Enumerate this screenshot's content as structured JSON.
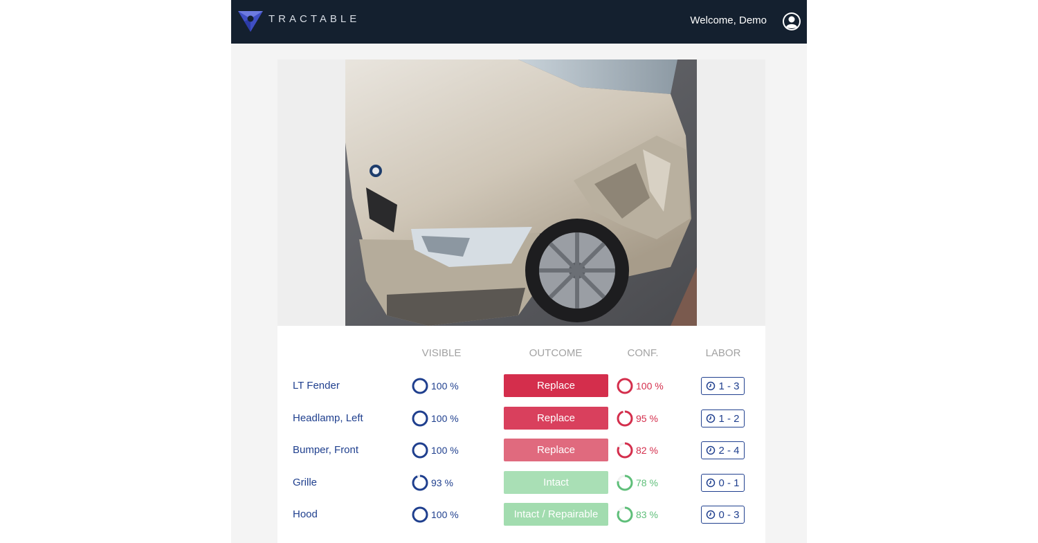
{
  "header": {
    "brand": "TRACTABLE",
    "welcome": "Welcome, Demo"
  },
  "columns": {
    "visible": "VISIBLE",
    "outcome": "OUTCOME",
    "conf": "CONF.",
    "labor": "LABOR"
  },
  "colors": {
    "navy": "#14202f",
    "blue": "#1f3f8e",
    "red": "#d42e4c",
    "red_light": "#e06a7e",
    "green": "#5fbf7a",
    "green_light": "#a9dfb5"
  },
  "rows": [
    {
      "part": "LT Fender",
      "visible": "100 %",
      "visible_pct": 100,
      "outcome": "Replace",
      "outcome_color": "#d42e4c",
      "conf": "100 %",
      "conf_pct": 100,
      "conf_color": "#d42e4c",
      "labor": "1 - 3"
    },
    {
      "part": "Headlamp, Left",
      "visible": "100 %",
      "visible_pct": 100,
      "outcome": "Replace",
      "outcome_color": "#d9405d",
      "conf": "95 %",
      "conf_pct": 95,
      "conf_color": "#d42e4c",
      "labor": "1 - 2"
    },
    {
      "part": "Bumper, Front",
      "visible": "100 %",
      "visible_pct": 100,
      "outcome": "Replace",
      "outcome_color": "#e06a7e",
      "conf": "82 %",
      "conf_pct": 82,
      "conf_color": "#d42e4c",
      "labor": "2 - 4"
    },
    {
      "part": "Grille",
      "visible": "93 %",
      "visible_pct": 93,
      "outcome": "Intact",
      "outcome_color": "#a9dfb5",
      "conf": "78 %",
      "conf_pct": 78,
      "conf_color": "#5fbf7a",
      "labor": "0 - 1"
    },
    {
      "part": "Hood",
      "visible": "100 %",
      "visible_pct": 100,
      "outcome": "Intact / Repairable",
      "outcome_color": "#a2dcaf",
      "conf": "83 %",
      "conf_pct": 83,
      "conf_color": "#5fbf7a",
      "labor": "0 - 3"
    }
  ]
}
